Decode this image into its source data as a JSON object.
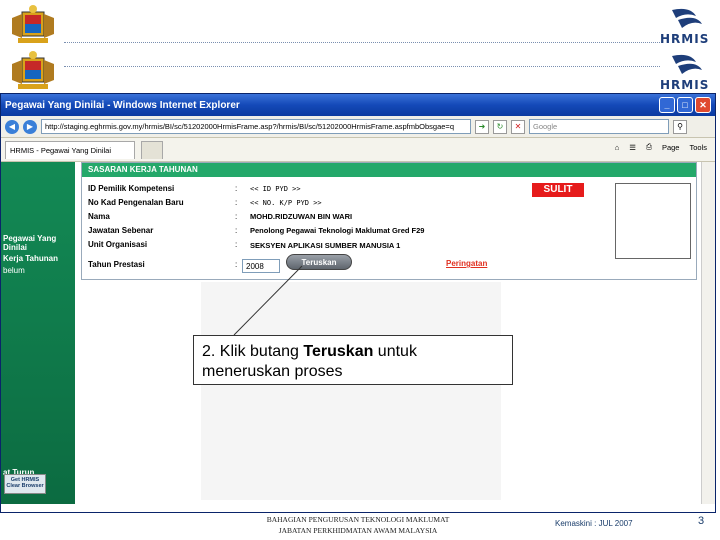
{
  "slide": {
    "logo_text": "HRMIS",
    "footer_line1": "BAHAGIAN PENGURUSAN TEKNOLOGI MAKLUMAT",
    "footer_line2": "JABATAN PERKHIDMATAN AWAM MALAYSIA",
    "footer_date": "JUL 2007",
    "footer_date_prefix": "Kemaskini :",
    "page_number": "3"
  },
  "browser": {
    "title": "Pegawai Yang Dinilai - Windows Internet Explorer",
    "url": "http://staging.eghrmis.gov.my/hrmis/BI/sc/51202000HrmisFrame.asp?/hrmis/BI/sc/51202000HrmisFrame.aspfmbObsgae=q",
    "search_placeholder": "Google",
    "tab_label": "HRMIS - Pegawai Yang Dinilai",
    "cmd_page": "Page",
    "cmd_tools": "Tools"
  },
  "sidebar": {
    "items": [
      "Pegawai Yang Dinilai",
      "Kerja Tahunan",
      "belum",
      "at Turun"
    ],
    "get_btn_line1": "Get HRMIS",
    "get_btn_line2": "Clear Browser"
  },
  "form": {
    "header": "SASARAN KERJA TAHUNAN",
    "labels": [
      "ID Pemilik Kompetensi",
      "No Kad Pengenalan Baru",
      "Nama",
      "Jawatan Sebenar",
      "Unit Organisasi",
      "Tahun Prestasi"
    ],
    "values": [
      "<< ID PYD >>",
      "<< NO. K/P PYD >>",
      "MOHD.RIDZUWAN BIN WARI",
      "Penolong Pegawai Teknologi Maklumat Gred F29",
      "SEKSYEN APLIKASI SUMBER MANUSIA 1"
    ],
    "year": "2008",
    "classification": "SULIT",
    "submit_label": "Teruskan",
    "warning_link": "Peringatan"
  },
  "callout": {
    "line1_pre": "2. Klik butang ",
    "line1_bold": "Teruskan",
    "line1_post": " untuk",
    "line2": "meneruskan proses"
  }
}
